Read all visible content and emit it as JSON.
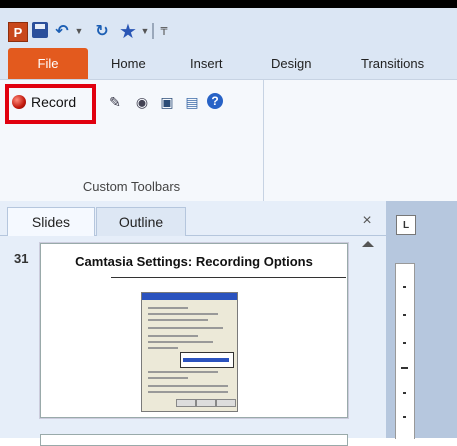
{
  "qat": {
    "app_icon": "P",
    "icons": [
      "powerpoint-logo-icon",
      "save-icon",
      "undo-icon",
      "dropdown-icon",
      "redo-icon",
      "star-icon",
      "dropdown-icon",
      "customize-qat-icon"
    ]
  },
  "tabs": [
    {
      "label": "File"
    },
    {
      "label": "Home"
    },
    {
      "label": "Insert"
    },
    {
      "label": "Design"
    },
    {
      "label": "Transitions"
    }
  ],
  "ribbon": {
    "record_label": "Record",
    "group_label": "Custom Toolbars",
    "help_glyph": "?",
    "highlight_color": "#e1000f"
  },
  "pane": {
    "tabs": [
      {
        "label": "Slides"
      },
      {
        "label": "Outline"
      }
    ],
    "close_glyph": "×",
    "slide_number": "31",
    "slide_title": "Camtasia Settings: Recording Options"
  },
  "ruler": {
    "button_glyph": "L"
  },
  "colors": {
    "file_tab": "#e35a1e",
    "ribbon_bg": "#f5f8fc",
    "pane_bg": "#e6eef9"
  }
}
